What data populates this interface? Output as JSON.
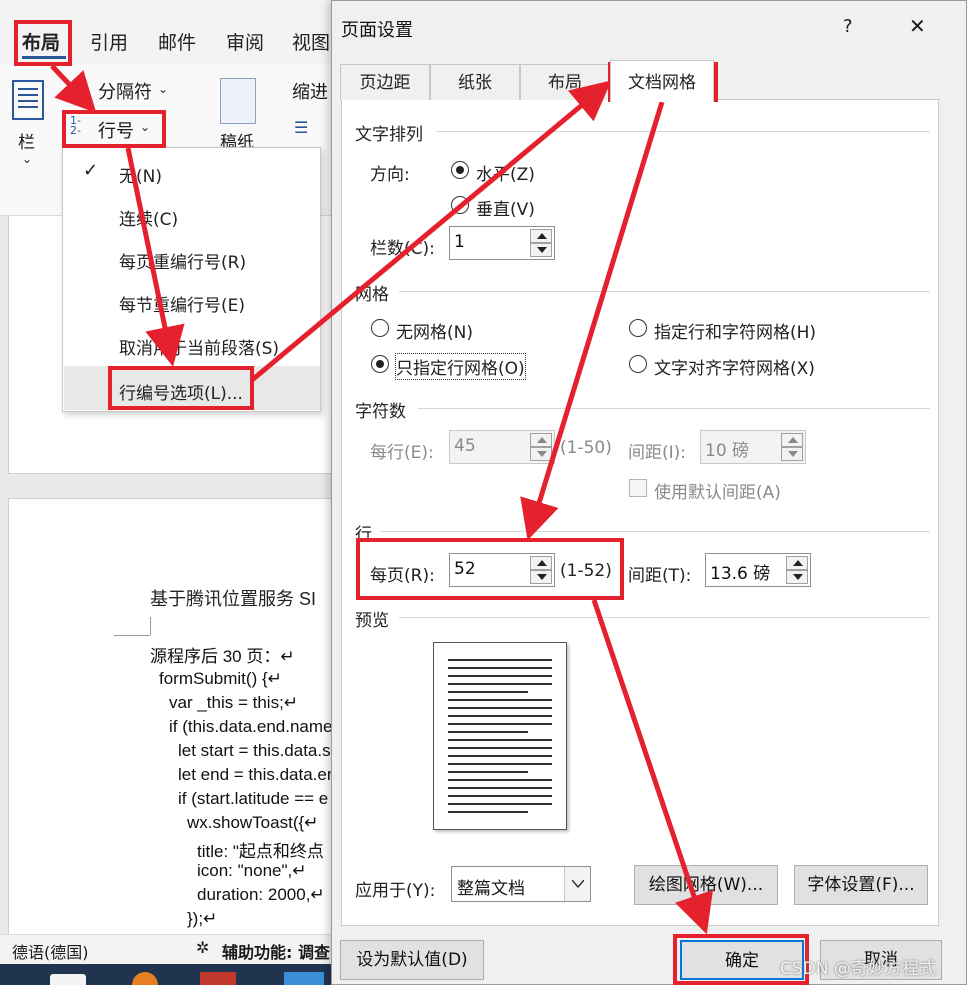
{
  "word": {
    "ribbon_tabs": [
      "布局",
      "引用",
      "邮件",
      "审阅",
      "视图"
    ],
    "ribbon_buttons": {
      "breaks": "分隔符",
      "line_numbers": "行号",
      "indent": "缩进",
      "columns": "栏",
      "draft_paper": "稿纸"
    },
    "line_number_menu": [
      "无(N)",
      "连续(C)",
      "每页重编行号(R)",
      "每节重编行号(E)",
      "取消用于当前段落(S)",
      "行编号选项(L)..."
    ],
    "doc_title": "基于腾讯位置服务 SI",
    "doc_lines": [
      "源程序后 30 页：↵",
      "formSubmit() {↵",
      "var _this = this;↵",
      "if (this.data.end.name",
      "let start = this.data.s",
      "let end = this.data.en",
      "if (start.latitude == e",
      "wx.showToast({↵",
      "title: \"起点和终点",
      "icon: \"none\",↵",
      "duration: 2000,↵",
      "});↵"
    ],
    "status_language": "德语(德国)",
    "status_accessibility": "辅助功能: 调查"
  },
  "dialog": {
    "title": "页面设置",
    "help": "?",
    "close": "✕",
    "tabs": [
      "页边距",
      "纸张",
      "布局",
      "文档网格"
    ],
    "text_direction": {
      "heading": "文字排列",
      "direction_label": "方向:",
      "horizontal": "水平(Z)",
      "vertical": "垂直(V)",
      "columns_label": "栏数(C):",
      "columns_value": "1"
    },
    "grid": {
      "heading": "网格",
      "none": "无网格(N)",
      "lines_only": "只指定行网格(O)",
      "lines_and_chars": "指定行和字符网格(H)",
      "snap_chars": "文字对齐字符网格(X)"
    },
    "characters": {
      "heading": "字符数",
      "per_line_label": "每行(E):",
      "per_line_value": "45",
      "per_line_range": "(1-50)",
      "pitch_label": "间距(I):",
      "pitch_value": "10 磅",
      "use_default_pitch": "使用默认间距(A)"
    },
    "lines": {
      "heading": "行",
      "per_page_label": "每页(R):",
      "per_page_value": "52",
      "per_page_range": "(1-52)",
      "pitch_label": "间距(T):",
      "pitch_value": "13.6 磅"
    },
    "preview": {
      "heading": "预览",
      "line_count": 20
    },
    "apply_to_label": "应用于(Y):",
    "apply_to_value": "整篇文档",
    "drawing_grid_button": "绘图网格(W)...",
    "font_settings_button": "字体设置(F)...",
    "set_default_button": "设为默认值(D)",
    "ok_button": "确定",
    "cancel_button": "取消"
  },
  "watermark": "CSDN @奇妙方程式",
  "colors": {
    "annotation_red": "#e5212e",
    "focus_blue": "#0078d7"
  }
}
